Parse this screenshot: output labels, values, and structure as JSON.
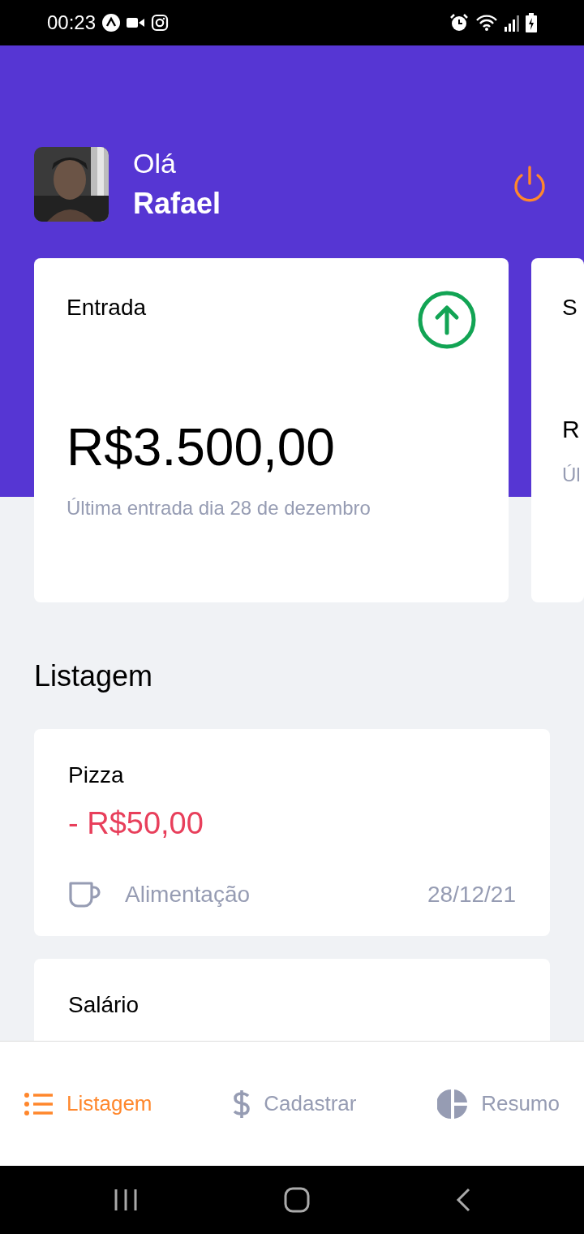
{
  "status_bar": {
    "time": "00:23"
  },
  "header": {
    "greeting": "Olá",
    "user_name": "Rafael"
  },
  "highlight_cards": [
    {
      "kind": "income",
      "title": "Entrada",
      "amount": "R$3.500,00",
      "last_transaction": "Última entrada dia 28 de dezembro"
    },
    {
      "kind": "cut",
      "title": "S",
      "amount": "R",
      "last_transaction": "Úl"
    }
  ],
  "section_title": "Listagem",
  "transactions": [
    {
      "kind": "expense",
      "title": "Pizza",
      "amount": "- R$50,00",
      "category": "Alimentação",
      "date": "28/12/21"
    },
    {
      "title": "Salário"
    }
  ],
  "tabs": [
    {
      "label": "Listagem",
      "selected": true
    },
    {
      "label": "Cadastrar",
      "selected": false
    },
    {
      "label": "Resumo",
      "selected": false
    }
  ]
}
